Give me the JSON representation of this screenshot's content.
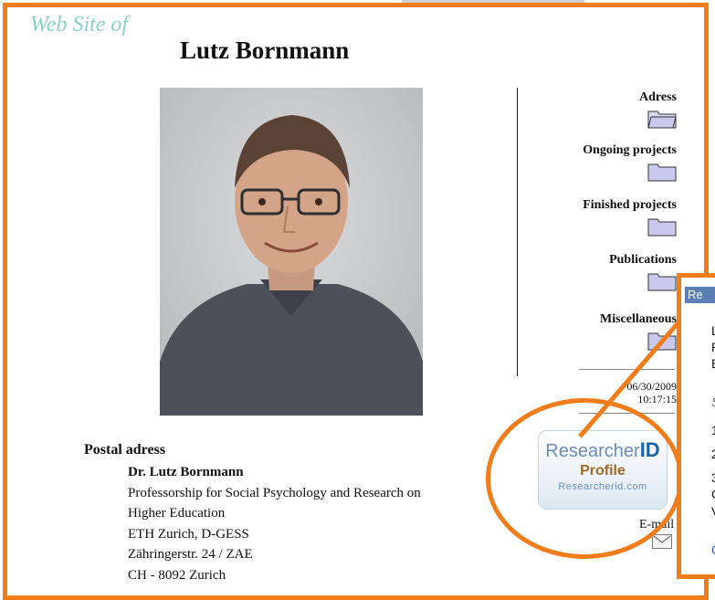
{
  "header": {
    "site_label": "Web Site of",
    "name": "Lutz Bornmann"
  },
  "nav": [
    {
      "label": "Adress",
      "icon": "folder-open-icon"
    },
    {
      "label": "Ongoing projects",
      "icon": "folder-icon"
    },
    {
      "label": "Finished projects",
      "icon": "folder-icon"
    },
    {
      "label": "Publications",
      "icon": "folder-icon"
    },
    {
      "label": "Miscellaneous",
      "icon": "folder-icon"
    }
  ],
  "updated": {
    "date": "06/30/2009",
    "time": "10:17:15"
  },
  "postal": {
    "heading": "Postal adress",
    "name": "Dr. Lutz Bornmann",
    "lines": [
      "Professorship for Social Psychology and Research on",
      "Higher Education",
      "ETH Zurich, D-GESS",
      "Zähringerstr. 24 / ZAE",
      "CH - 8092 Zurich"
    ]
  },
  "badge": {
    "brand": "Researcher",
    "brand_id": "ID",
    "profile": "Profile",
    "url": "Researcherid.com"
  },
  "email": {
    "label": "E-mail"
  },
  "callout": {
    "header": "Re",
    "lines": [
      "L",
      "P",
      "E",
      "S",
      "1",
      "2",
      "3",
      "C",
      "V",
      "G"
    ]
  },
  "colors": {
    "accent": "#f07d1a",
    "site_label": "#8ad0c8",
    "folder": "#c9c8ee"
  }
}
